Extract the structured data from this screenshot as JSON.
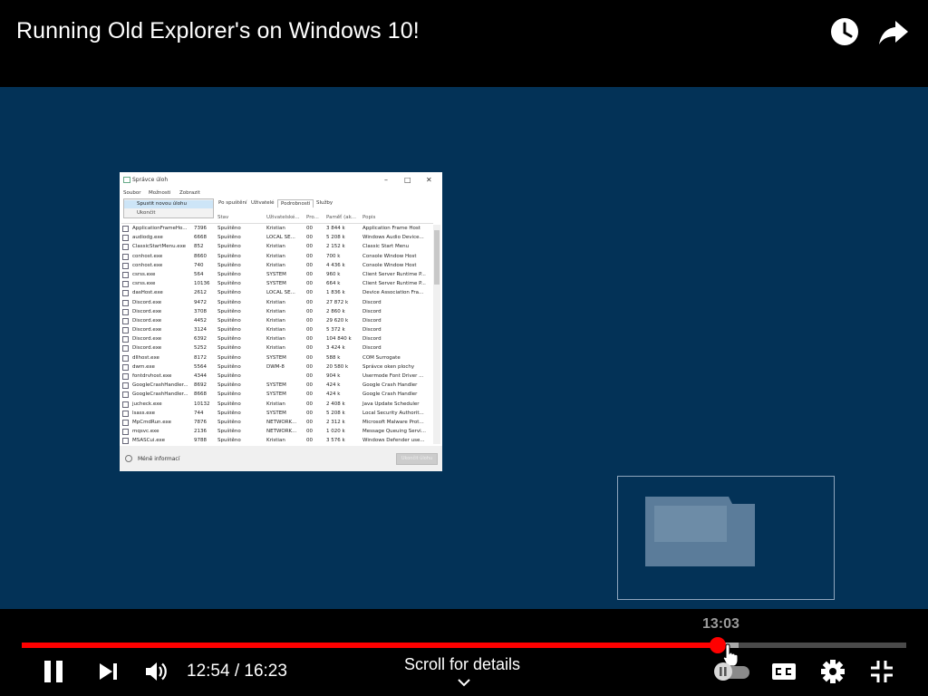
{
  "header": {
    "title": "Running Old Explorer's on Windows 10!",
    "watch_later_icon": "clock-icon",
    "share_icon": "share-arrow-icon"
  },
  "video": {
    "background_color": "#033257",
    "task_manager": {
      "title": "Správce úloh",
      "menus": [
        "Soubor",
        "Možnosti",
        "Zobrazit"
      ],
      "dropdown": {
        "items": [
          "Spustit novou úlohu",
          "Ukončit"
        ]
      },
      "tabs": [
        "Po spuštění",
        "Uživatelé",
        "Podrobnosti",
        "Služby"
      ],
      "active_tab": "Podrobnosti",
      "columns": [
        "Název",
        "PID",
        "Stav",
        "Uživatelské...",
        "Pro...",
        "Paměť (ak...",
        "Popis"
      ],
      "rows": [
        [
          "ApplicationFrameHo...",
          "7396",
          "Spuštěno",
          "Kristian",
          "00",
          "3 844 k",
          "Application Frame Host"
        ],
        [
          "audiodg.exe",
          "6668",
          "Spuštěno",
          "LOCAL SE...",
          "00",
          "5 208 k",
          "Windows Audio Device..."
        ],
        [
          "ClassicStartMenu.exe",
          "852",
          "Spuštěno",
          "Kristian",
          "00",
          "2 152 k",
          "Classic Start Menu"
        ],
        [
          "conhost.exe",
          "8660",
          "Spuštěno",
          "Kristian",
          "00",
          "700 k",
          "Console Window Host"
        ],
        [
          "conhost.exe",
          "740",
          "Spuštěno",
          "Kristian",
          "00",
          "4 436 k",
          "Console Window Host"
        ],
        [
          "csrss.exe",
          "564",
          "Spuštěno",
          "SYSTEM",
          "00",
          "960 k",
          "Client Server Runtime P..."
        ],
        [
          "csrss.exe",
          "10136",
          "Spuštěno",
          "SYSTEM",
          "00",
          "664 k",
          "Client Server Runtime P..."
        ],
        [
          "dasHost.exe",
          "2612",
          "Spuštěno",
          "LOCAL SE...",
          "00",
          "1 836 k",
          "Device Association Fra..."
        ],
        [
          "Discord.exe",
          "9472",
          "Spuštěno",
          "Kristian",
          "00",
          "27 872 k",
          "Discord"
        ],
        [
          "Discord.exe",
          "3708",
          "Spuštěno",
          "Kristian",
          "00",
          "2 860 k",
          "Discord"
        ],
        [
          "Discord.exe",
          "4452",
          "Spuštěno",
          "Kristian",
          "00",
          "29 620 k",
          "Discord"
        ],
        [
          "Discord.exe",
          "3124",
          "Spuštěno",
          "Kristian",
          "00",
          "5 372 k",
          "Discord"
        ],
        [
          "Discord.exe",
          "6392",
          "Spuštěno",
          "Kristian",
          "00",
          "104 840 k",
          "Discord"
        ],
        [
          "Discord.exe",
          "5252",
          "Spuštěno",
          "Kristian",
          "00",
          "3 424 k",
          "Discord"
        ],
        [
          "dllhost.exe",
          "8172",
          "Spuštěno",
          "SYSTEM",
          "00",
          "588 k",
          "COM Surrogate"
        ],
        [
          "dwm.exe",
          "5564",
          "Spuštěno",
          "DWM-8",
          "00",
          "20 580 k",
          "Správce oken plochy"
        ],
        [
          "fontdrvhost.exe",
          "4344",
          "Spuštěno",
          "",
          "00",
          "904 k",
          "Usermode Font Driver ..."
        ],
        [
          "GoogleCrashHandler...",
          "8692",
          "Spuštěno",
          "SYSTEM",
          "00",
          "424 k",
          "Google Crash Handler"
        ],
        [
          "GoogleCrashHandler...",
          "8668",
          "Spuštěno",
          "SYSTEM",
          "00",
          "424 k",
          "Google Crash Handler"
        ],
        [
          "jucheck.exe",
          "10132",
          "Spuštěno",
          "Kristian",
          "00",
          "2 408 k",
          "Java Update Scheduler"
        ],
        [
          "lsass.exe",
          "744",
          "Spuštěno",
          "SYSTEM",
          "00",
          "5 208 k",
          "Local Security Authorit..."
        ],
        [
          "MpCmdRun.exe",
          "7876",
          "Spuštěno",
          "NETWORK...",
          "00",
          "2 312 k",
          "Microsoft Malware Prot..."
        ],
        [
          "mqsvc.exe",
          "2136",
          "Spuštěno",
          "NETWORK...",
          "00",
          "1 020 k",
          "Message Queuing Servi..."
        ],
        [
          "MSASCui.exe",
          "9788",
          "Spuštěno",
          "Kristian",
          "00",
          "3 576 k",
          "Windows Defender use..."
        ]
      ],
      "footer_less": "Méně informací",
      "end_task_label": "Ukončit úlohu"
    }
  },
  "player": {
    "seek_tooltip": "13:03",
    "time_display": "12:54 / 16:23",
    "scroll_hint": "Scroll for details",
    "played_fraction": 0.7868,
    "buffered_fraction": 0.81,
    "hover_fraction": 0.7968,
    "colors": {
      "progress": "#ff0000",
      "buffer": "#a8a8a8",
      "track": "#4a4a4a"
    },
    "buttons": {
      "pause": "pause-icon",
      "next": "next-icon",
      "volume": "volume-icon",
      "autoplay": "autoplay-toggle-icon",
      "captions": "captions-icon",
      "settings": "gear-icon",
      "exit_fullscreen": "exit-fullscreen-icon"
    }
  }
}
